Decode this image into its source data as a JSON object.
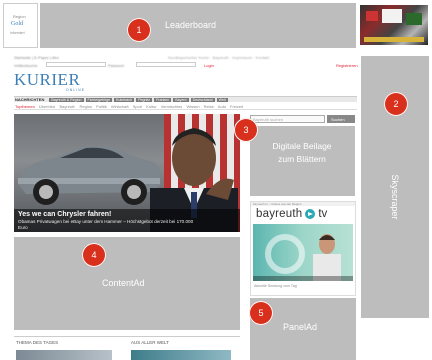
{
  "ads": {
    "leaderboard": {
      "number": "1",
      "label": "Leaderboard"
    },
    "skyscraper": {
      "number": "2",
      "label": "Skyscraper"
    },
    "digital_supplement": {
      "number": "3",
      "label": "Digitale Beilage zum Blättern"
    },
    "content_ad": {
      "number": "4",
      "label": "ContentAd"
    },
    "panel_ad": {
      "number": "5",
      "label": "PanelAd"
    }
  },
  "small_ad": {
    "line1": "Region",
    "line2": "Gold",
    "line3": "informiert"
  },
  "header": {
    "logo": "KURIER",
    "logo_sub": "ONLINE",
    "top_links": "Startseite | E-Paper | Abo",
    "meta_links": "Nordbayerischer Kurier · Bayreuth · Impressum · Kontakt",
    "search_label": "Volltextsuche",
    "login_label": "Passwort",
    "login_link": "Login",
    "register_link": "Registrieren"
  },
  "nav": {
    "label": "NACHRICHTEN",
    "items": [
      "Bayreuth & Region",
      "Fichtelgebirge",
      "Kulmbach",
      "Pegnitz",
      "Franken",
      "Bayern",
      "Deutschland",
      "Welt"
    ],
    "subitems": [
      "Topthemen",
      "Überblick",
      "Bayreuth",
      "Region",
      "Politik",
      "Wirtschaft",
      "Sport",
      "Kultur",
      "Vermischtes",
      "Wissen",
      "Reise",
      "Auto",
      "Freizeit"
    ]
  },
  "headline": {
    "title": "Yes we can Chrysler fahren!",
    "teaser": "Obamas Privatwagen bei eBay unter dem Hammer – Höchstgebot derzeit bei 170.000 Euro"
  },
  "tv": {
    "name": "bayreuth",
    "suffix": "tv",
    "topbar": "bayreuth.tv – Videos aus der Region",
    "caption": "Aktuelle Sendung vom Tag"
  },
  "sidebar": {
    "search_placeholder": "Bayreuth suchen",
    "search_button": "Suchen"
  },
  "sections": {
    "left": "THEMA DES TAGES",
    "right": "AUS ALLER WELT"
  },
  "colors": {
    "badge": "#d8301d",
    "ad_gray": "#bdbdbd",
    "tv_teal": "#2aa9b5",
    "logo_blue": "#3d7fb5"
  }
}
